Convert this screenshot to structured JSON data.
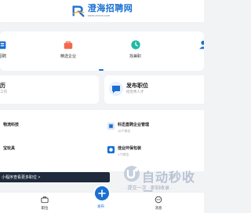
{
  "header": {
    "logo_text": "澄海招聘网",
    "logo_url": "www.chcrw.com"
  },
  "categories": [
    {
      "label": "招聘",
      "icon": "building-icon"
    },
    {
      "label": "精选企业",
      "icon": "bag-icon"
    },
    {
      "label": "找兼职",
      "icon": "clock-icon"
    }
  ],
  "cards": {
    "resume": {
      "title": "历",
      "sub": "工作"
    },
    "post_job": {
      "title": "发布职位",
      "sub": "招优秀人才"
    }
  },
  "companies": [
    {
      "name": "物流科技",
      "jobs": ""
    },
    {
      "name": "科迅直聘企业管理",
      "jobs": "15个岗位"
    },
    {
      "name": "宝玩具",
      "jobs": ""
    },
    {
      "name": "佳业环保包装",
      "jobs": "1个岗位"
    }
  ],
  "banner": {
    "text": "小程序查看更多职位 >"
  },
  "watermark": {
    "main": "自动秒收录",
    "sub": "· 提交一次 · 即刻收录 ·"
  },
  "tabbar": {
    "left": "职位",
    "center": "发布",
    "right": "消息"
  },
  "colors": {
    "accent": "#1a6fd1",
    "banner_bg": "#1f2a3c"
  }
}
